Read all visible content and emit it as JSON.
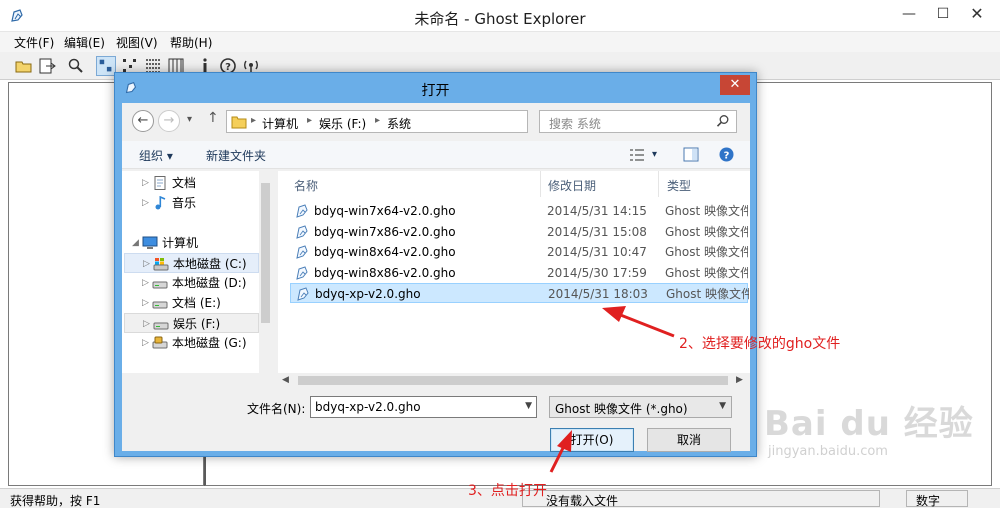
{
  "window": {
    "title": "未命名 - Ghost Explorer",
    "min_glyph": "—",
    "max_glyph": "☐",
    "close_glyph": "✕"
  },
  "menu": {
    "file": "文件(F)",
    "edit": "编辑(E)",
    "view": "视图(V)",
    "help": "帮助(H)"
  },
  "toolbar": {
    "icons": [
      "open-icon",
      "extract-icon",
      "find-icon",
      "large-icons-icon",
      "small-icons-icon",
      "list-icon",
      "details-icon",
      "properties-icon",
      "help-icon",
      "about-icon"
    ]
  },
  "status": {
    "help": "获得帮助，按 F1",
    "file": "没有载入文件",
    "num": "数字"
  },
  "dialog": {
    "title": "打开",
    "close": "✕",
    "nav": {
      "back": "←",
      "forward": "→",
      "recent": "▾",
      "up": "↑"
    },
    "path": [
      "计算机",
      "娱乐 (F:)",
      "系统"
    ],
    "path_sep": "▸",
    "addr_dropdown": "⌄",
    "refresh": "↻",
    "search_placeholder": "搜索 系统",
    "commands": {
      "organize": "组织 ▾",
      "new_folder": "新建文件夹",
      "view_menu": "▾"
    },
    "tree": [
      {
        "label": "文档",
        "icon": "document-icon"
      },
      {
        "label": "音乐",
        "icon": "music-icon"
      },
      {
        "label": "计算机",
        "icon": "computer-icon"
      },
      {
        "label": "本地磁盘 (C:)",
        "icon": "system-drive-icon"
      },
      {
        "label": "本地磁盘 (D:)",
        "icon": "drive-icon"
      },
      {
        "label": "文档 (E:)",
        "icon": "drive-icon"
      },
      {
        "label": "娱乐 (F:)",
        "icon": "drive-icon"
      },
      {
        "label": "本地磁盘 (G:)",
        "icon": "locked-drive-icon"
      }
    ],
    "tree_arrows": {
      "collapsed": "▷",
      "expanded": "◢"
    },
    "columns": {
      "name": "名称",
      "date": "修改日期",
      "type": "类型"
    },
    "files": [
      {
        "name": "bdyq-win7x64-v2.0.gho",
        "date": "2014/5/31 14:15",
        "type": "Ghost 映像文件"
      },
      {
        "name": "bdyq-win7x86-v2.0.gho",
        "date": "2014/5/31 15:08",
        "type": "Ghost 映像文件"
      },
      {
        "name": "bdyq-win8x64-v2.0.gho",
        "date": "2014/5/31 10:47",
        "type": "Ghost 映像文件"
      },
      {
        "name": "bdyq-win8x86-v2.0.gho",
        "date": "2014/5/30 17:59",
        "type": "Ghost 映像文件"
      },
      {
        "name": "bdyq-xp-v2.0.gho",
        "date": "2014/5/31 18:03",
        "type": "Ghost 映像文件"
      }
    ],
    "selected_file_index": 4,
    "scroll_left": "◀",
    "scroll_right": "▶",
    "filename_label": "文件名(N):",
    "filename_value": "bdyq-xp-v2.0.gho",
    "filetype_value": "Ghost 映像文件 (*.gho)",
    "dropdown_glyph": "▼",
    "open_button": "打开(O)",
    "cancel_button": "取消"
  },
  "annotations": {
    "step2": "2、选择要修改的gho文件",
    "step3": "3、点击打开"
  },
  "watermark": {
    "brand": "Bai du 经验",
    "url": "jingyan.baidu.com"
  },
  "colors": {
    "dialog_frame": "#6aaee8",
    "annotation": "#e02020",
    "selection": "#cce8ff",
    "close_button": "#c74635"
  }
}
